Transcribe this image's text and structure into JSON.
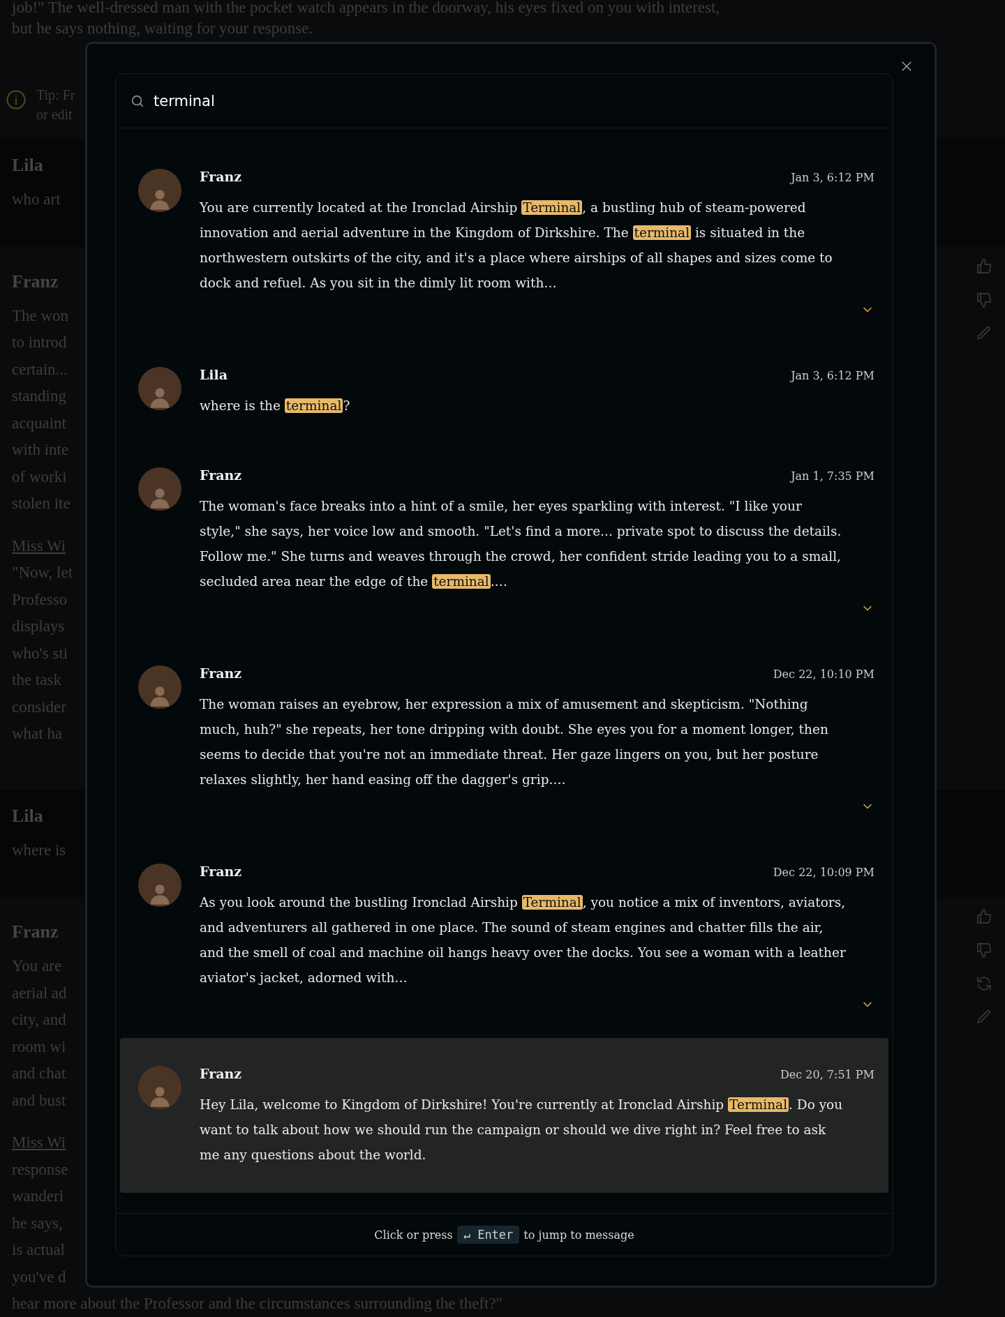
{
  "background": {
    "intro_lines": [
      "job!\" The well-dressed man with the pocket watch appears in the doorway, his eyes fixed on you with interest,",
      "but he says nothing, waiting for your response."
    ],
    "tip": {
      "lines": [
        "Tip: Fr",
        "or edit"
      ]
    },
    "messages": [
      {
        "kind": "user",
        "author": "Lila",
        "paragraphs": [
          {
            "kind": "text",
            "lines": [
              "who art"
            ]
          }
        ]
      },
      {
        "kind": "ai",
        "author": "Franz",
        "paragraphs": [
          {
            "kind": "text",
            "lines": [
              "The won",
              "to introd",
              "certain...",
              "standing",
              "acquaint",
              "with inte",
              "of worki",
              "stolen ite"
            ]
          },
          {
            "kind": "speaker",
            "lines": [
              "Miss Wi"
            ]
          },
          {
            "kind": "text",
            "lines": [
              "\"Now, let",
              "Professo",
              "displays",
              "who's sti",
              "the task",
              "consider",
              "what ha"
            ]
          }
        ]
      },
      {
        "kind": "user",
        "author": "Lila",
        "paragraphs": [
          {
            "kind": "text",
            "lines": [
              "where is"
            ]
          }
        ]
      },
      {
        "kind": "ai",
        "author": "Franz",
        "paragraphs": [
          {
            "kind": "text",
            "lines": [
              "You are",
              "aerial ad",
              "city, and",
              "room wi",
              "and chat",
              "and bust"
            ]
          },
          {
            "kind": "speaker",
            "lines": [
              "Miss Wi"
            ]
          },
          {
            "kind": "text",
            "lines": [
              "response",
              "wanderi",
              "he says,",
              "is actual",
              "you've d",
              "hear more about the Professor and the circumstances surrounding the theft?\""
            ]
          }
        ]
      }
    ]
  },
  "search_dialog": {
    "query": "terminal",
    "results": [
      {
        "author": "Franz",
        "time": "Jan 3, 6:12 PM",
        "selected": false,
        "expandable": true,
        "body": [
          {
            "text": "You are currently located at the Ironclad Airship ",
            "highlight": false
          },
          {
            "text": "Terminal",
            "highlight": true
          },
          {
            "text": ", a bustling hub of steam-powered innovation and aerial adventure in the Kingdom of Dirkshire. The ",
            "highlight": false
          },
          {
            "text": "terminal",
            "highlight": true
          },
          {
            "text": " is situated in the northwestern outskirts of the city, and it's a place where airships of all shapes and sizes come to dock and refuel. As you sit in the dimly lit room with…",
            "highlight": false
          }
        ]
      },
      {
        "author": "Lila",
        "time": "Jan 3, 6:12 PM",
        "selected": false,
        "expandable": false,
        "body": [
          {
            "text": "where is the ",
            "highlight": false
          },
          {
            "text": "terminal",
            "highlight": true
          },
          {
            "text": "?",
            "highlight": false
          }
        ]
      },
      {
        "author": "Franz",
        "time": "Jan 1, 7:35 PM",
        "selected": false,
        "expandable": true,
        "body": [
          {
            "text": "The woman's face breaks into a hint of a smile, her eyes sparkling with interest. \"I like your style,\" she says, her voice low and smooth. \"Let's find a more... private spot to discuss the details. Follow me.\" She turns and weaves through the crowd, her confident stride leading you to a small, secluded area near the edge of the ",
            "highlight": false
          },
          {
            "text": "terminal",
            "highlight": true
          },
          {
            "text": ".…",
            "highlight": false
          }
        ]
      },
      {
        "author": "Franz",
        "time": "Dec 22, 10:10 PM",
        "selected": false,
        "expandable": true,
        "body": [
          {
            "text": "The woman raises an eyebrow, her expression a mix of amusement and skepticism. \"Nothing much, huh?\" she repeats, her tone dripping with doubt. She eyes you for a moment longer, then seems to decide that you're not an immediate threat. Her gaze lingers on you, but her posture relaxes slightly, her hand easing off the dagger's grip.…",
            "highlight": false
          }
        ]
      },
      {
        "author": "Franz",
        "time": "Dec 22, 10:09 PM",
        "selected": false,
        "expandable": true,
        "body": [
          {
            "text": "As you look around the bustling Ironclad Airship ",
            "highlight": false
          },
          {
            "text": "Terminal",
            "highlight": true
          },
          {
            "text": ", you notice a mix of inventors, aviators, and adventurers all gathered in one place. The sound of steam engines and chatter fills the air, and the smell of coal and machine oil hangs heavy over the docks. You see a woman with a leather aviator's jacket, adorned with…",
            "highlight": false
          }
        ]
      },
      {
        "author": "Franz",
        "time": "Dec 20, 7:51 PM",
        "selected": true,
        "expandable": false,
        "body": [
          {
            "text": "Hey Lila, welcome to Kingdom of Dirkshire! You're currently at Ironclad Airship ",
            "highlight": false
          },
          {
            "text": "Terminal",
            "highlight": true
          },
          {
            "text": ". Do you want to talk about how we should run the campaign or should we dive right in? Feel free to ask me any questions about the world.",
            "highlight": false
          }
        ]
      }
    ],
    "footer": {
      "before": "Click or press",
      "key": "↵ Enter",
      "after": "to jump to message"
    }
  }
}
